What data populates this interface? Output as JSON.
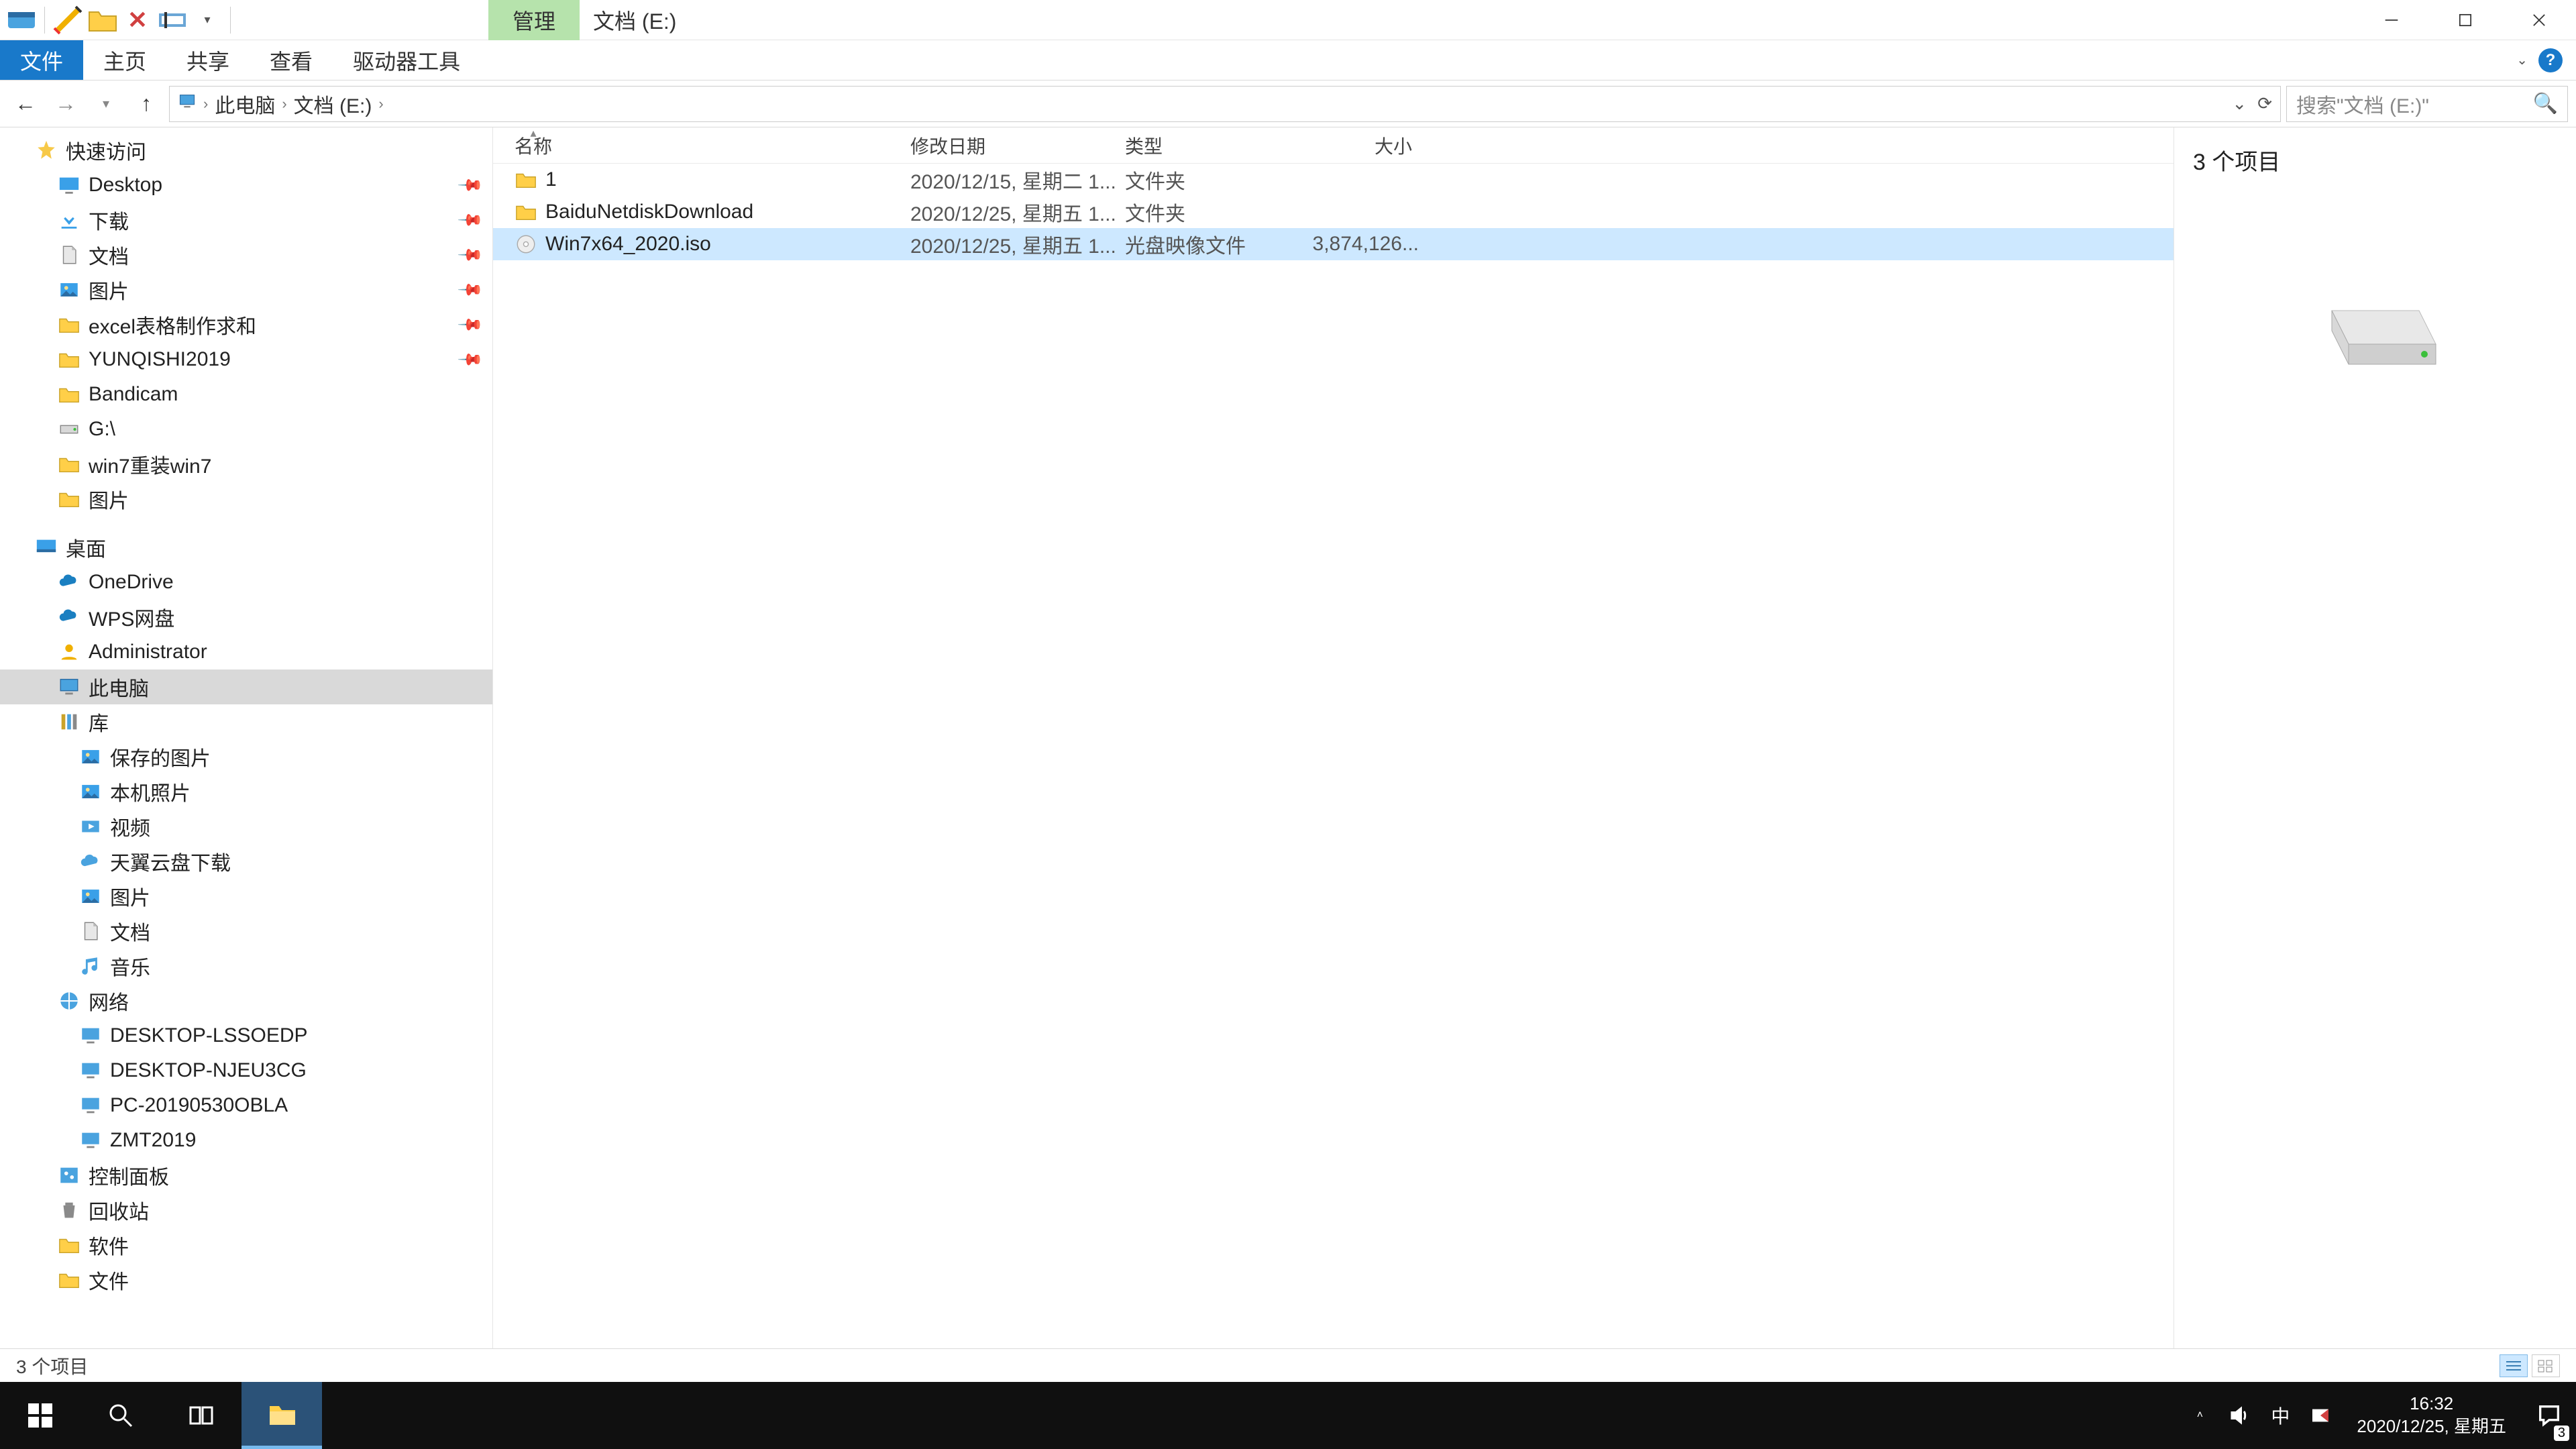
{
  "title": "文档 (E:)",
  "ribbon": {
    "file": "文件",
    "home": "主页",
    "share": "共享",
    "view": "查看",
    "context_group": "管理",
    "context_tab": "驱动器工具"
  },
  "address": {
    "root": "此电脑",
    "current": "文档 (E:)"
  },
  "search": {
    "placeholder": "搜索\"文档 (E:)\""
  },
  "columns": {
    "name": "名称",
    "date": "修改日期",
    "type": "类型",
    "size": "大小"
  },
  "rows": [
    {
      "name": "1",
      "date": "2020/12/15, 星期二 1...",
      "type": "文件夹",
      "size": "",
      "icon": "folder",
      "selected": false
    },
    {
      "name": "BaiduNetdiskDownload",
      "date": "2020/12/25, 星期五 1...",
      "type": "文件夹",
      "size": "",
      "icon": "folder",
      "selected": false
    },
    {
      "name": "Win7x64_2020.iso",
      "date": "2020/12/25, 星期五 1...",
      "type": "光盘映像文件",
      "size": "3,874,126...",
      "icon": "disc",
      "selected": true
    }
  ],
  "preview": {
    "count_text": "3 个项目"
  },
  "status": {
    "text": "3 个项目"
  },
  "tree": {
    "quick_access": "快速访问",
    "qa_items": [
      {
        "label": "Desktop",
        "icon": "desktop",
        "pin": true
      },
      {
        "label": "下载",
        "icon": "downloads",
        "pin": true
      },
      {
        "label": "文档",
        "icon": "documents",
        "pin": true
      },
      {
        "label": "图片",
        "icon": "pictures",
        "pin": true
      },
      {
        "label": "excel表格制作求和",
        "icon": "folder",
        "pin": true
      },
      {
        "label": "YUNQISHI2019",
        "icon": "folder",
        "pin": true
      },
      {
        "label": "Bandicam",
        "icon": "folder",
        "pin": false
      },
      {
        "label": "G:\\",
        "icon": "drive",
        "pin": false
      },
      {
        "label": "win7重装win7",
        "icon": "folder",
        "pin": false
      },
      {
        "label": "图片",
        "icon": "folder",
        "pin": false
      }
    ],
    "desktop": "桌面",
    "desktop_items": [
      {
        "label": "OneDrive",
        "icon": "onedrive"
      },
      {
        "label": "WPS网盘",
        "icon": "wps"
      },
      {
        "label": "Administrator",
        "icon": "user"
      },
      {
        "label": "此电脑",
        "icon": "pc",
        "selected": true
      },
      {
        "label": "库",
        "icon": "library"
      }
    ],
    "library_items": [
      {
        "label": "保存的图片",
        "icon": "pictures"
      },
      {
        "label": "本机照片",
        "icon": "pictures"
      },
      {
        "label": "视频",
        "icon": "video"
      },
      {
        "label": "天翼云盘下载",
        "icon": "cloud"
      },
      {
        "label": "图片",
        "icon": "pictures"
      },
      {
        "label": "文档",
        "icon": "documents"
      },
      {
        "label": "音乐",
        "icon": "music"
      }
    ],
    "network": "网络",
    "network_items": [
      {
        "label": "DESKTOP-LSSOEDP",
        "icon": "netpc"
      },
      {
        "label": "DESKTOP-NJEU3CG",
        "icon": "netpc"
      },
      {
        "label": "PC-20190530OBLA",
        "icon": "netpc"
      },
      {
        "label": "ZMT2019",
        "icon": "netpc"
      }
    ],
    "extra": [
      {
        "label": "控制面板",
        "icon": "control"
      },
      {
        "label": "回收站",
        "icon": "recycle"
      },
      {
        "label": "软件",
        "icon": "folder"
      },
      {
        "label": "文件",
        "icon": "folder"
      }
    ]
  },
  "taskbar": {
    "time": "16:32",
    "date": "2020/12/25, 星期五",
    "ime": "中",
    "notif_count": "3"
  }
}
